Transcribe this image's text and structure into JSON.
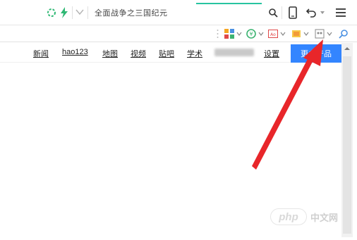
{
  "toolbar": {
    "search_text": "全面战争之三国纪元",
    "icons": [
      "refresh-icon",
      "bolt-icon",
      "chevron-down-icon",
      "search-icon",
      "phone-icon",
      "undo-icon",
      "menu-icon"
    ],
    "accent_color": "#27c4a0"
  },
  "extensions": [
    "app-grid-icon",
    "shield-icon",
    "translate-icon",
    "screenshot-icon",
    "ext-icon",
    "zoom-icon"
  ],
  "nav": {
    "links": [
      "新闻",
      "hao123",
      "地图",
      "视频",
      "贴吧",
      "学术"
    ],
    "settings": "设置",
    "more_button": "更多产品",
    "button_color": "#3385ff"
  },
  "annotation": {
    "arrow_color": "#e8262a"
  },
  "watermark": {
    "logo": "php",
    "text": "中文网"
  }
}
